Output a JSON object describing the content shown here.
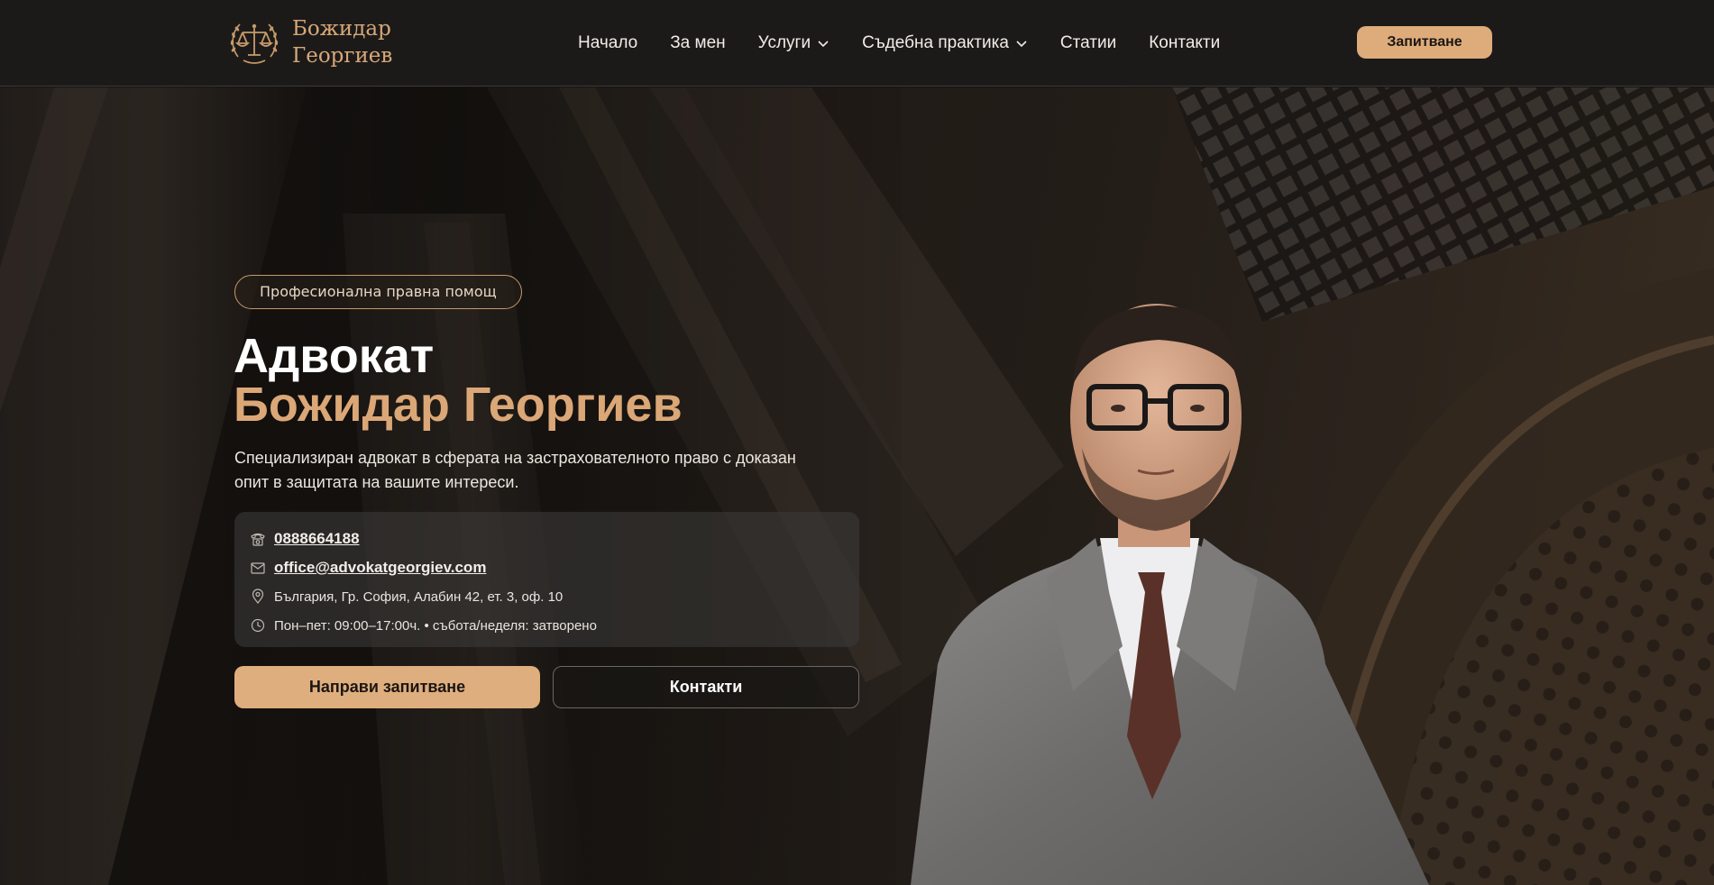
{
  "brand": {
    "name_line1": "Божидар",
    "name_line2": "Георгиев",
    "logo_icon": "scales-of-justice-laurel-icon",
    "accent_color": "#deac7a"
  },
  "nav": {
    "items": [
      {
        "label": "Начало",
        "has_dropdown": false
      },
      {
        "label": "За мен",
        "has_dropdown": false
      },
      {
        "label": "Услуги",
        "has_dropdown": true
      },
      {
        "label": "Съдебна практика",
        "has_dropdown": true
      },
      {
        "label": "Статии",
        "has_dropdown": false
      },
      {
        "label": "Контакти",
        "has_dropdown": false
      }
    ],
    "cta_label": "Запитване"
  },
  "hero": {
    "badge": "Професионална правна помощ",
    "title_line1": "Адвокат",
    "title_line2": "Божидар Георгиев",
    "lead": "Специализиран адвокат в сферата на застрахователното право с доказан опит в защитата на вашите интереси.",
    "contacts": {
      "phone": "0888664188",
      "email": "office@advokatgeorgiev.com",
      "address": "България, Гр. София, Алабин 42, ет. 3, оф. 10",
      "hours": "Пон–пет: 09:00–17:00ч. • събота/неделя: затворено"
    },
    "primary_button": "Направи запитване",
    "secondary_button": "Контакти"
  }
}
